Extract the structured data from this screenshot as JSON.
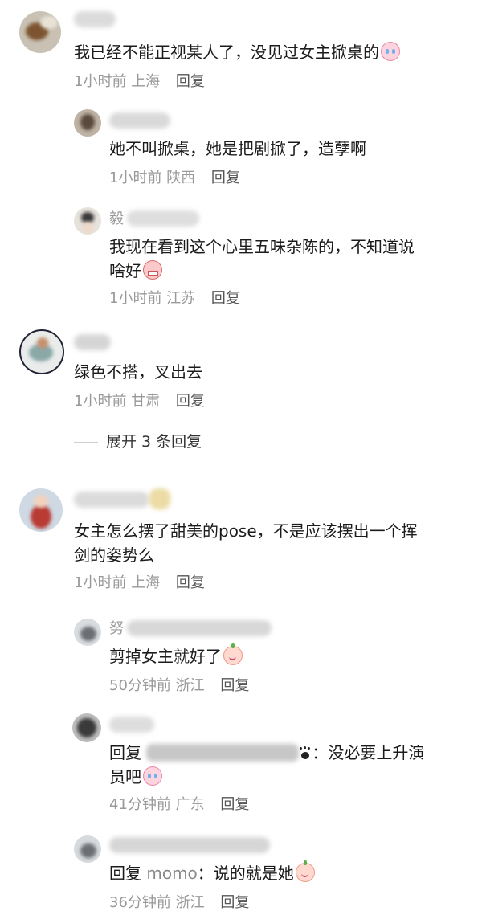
{
  "comments": [
    {
      "text": "我已经不能正视某人了，没见过女主掀桌的",
      "time": "1小时前",
      "location": "上海",
      "reply": "回复",
      "emoji": "crying-face-emoji"
    },
    {
      "text": "她不叫掀桌，她是把剧掀了，造孽啊",
      "time": "1小时前",
      "location": "陕西",
      "reply": "回复"
    },
    {
      "name_visible": "毅",
      "text_line1": "我现在看到这个心里五味杂陈的，不知道说",
      "text_line2": "啥好",
      "time": "1小时前",
      "location": "江苏",
      "reply": "回复",
      "emoji": "grimace-emoji"
    },
    {
      "text": "绿色不搭，叉出去",
      "time": "1小时前",
      "location": "甘肃",
      "reply": "回复",
      "expand": "展开 3 条回复"
    },
    {
      "text_line1": "女主怎么摆了甜美的pose，不是应该摆出一个挥",
      "text_line2": "剑的姿势么",
      "time": "1小时前",
      "location": "上海",
      "reply": "回复"
    },
    {
      "name_visible": "努",
      "text": "剪掉女主就好了",
      "time": "50分钟前",
      "location": "浙江",
      "reply": "回复",
      "emoji": "smile-emoji"
    },
    {
      "reply_prefix": "回复",
      "text_after_mention": "：没必要上升演",
      "text_line2": "员吧",
      "time": "41分钟前",
      "location": "广东",
      "reply": "回复",
      "emoji": "crying-face-emoji"
    },
    {
      "reply_prefix": "回复",
      "mention": "momo",
      "text_after_mention": "：说的就是她",
      "time": "36分钟前",
      "location": "浙江",
      "reply": "回复",
      "emoji": "smile-emoji"
    }
  ]
}
